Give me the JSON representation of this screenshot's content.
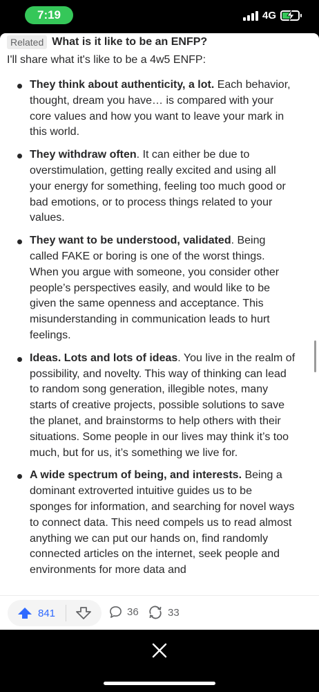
{
  "status": {
    "time": "7:19",
    "network": "4G"
  },
  "related": {
    "tag": "Related",
    "title": "What is it like to be an ENFP?"
  },
  "intro": "I'll share what it's like to be a 4w5 ENFP:",
  "points": [
    {
      "bold": "They think about authenticity, a lot.",
      "text": " Each behavior, thought, dream you have… is compared with your core values and how you want to leave your mark in this world."
    },
    {
      "bold": "They withdraw often",
      "text": ". It can either be due to overstimulation, getting really excited and using all your energy for something, feeling too much good or bad emotions, or to process things related to your values."
    },
    {
      "bold": "They want to be understood, validated",
      "text": ". Being called FAKE or boring is one of the worst things. When you argue with someone, you consider other people’s perspectives easily, and would like to be given the same openness and acceptance. This misunderstanding in communication leads to hurt feelings."
    },
    {
      "bold": "Ideas. Lots and lots of ideas",
      "text": ". You live in the realm of possibility, and novelty. This way of thinking can lead to random song generation, illegible notes, many starts of creative projects, possible solutions to save the planet, and brainstorms to help others with their situations. Some people in our lives may think it’s too much, but for us, it’s something we live for."
    },
    {
      "bold": "A wide spectrum of being, and interests.",
      "text": " Being a dominant extroverted intuitive guides us to be sponges for information, and searching for novel ways to connect data. This need compels us to read almost anything we can put our hands on, find randomly connected articles on the internet, seek people and environments for more data and"
    }
  ],
  "actions": {
    "upvotes": "841",
    "comments": "36",
    "shares": "33"
  },
  "colors": {
    "accent": "#2e69ff",
    "time_pill": "#35c759",
    "text": "#282829"
  },
  "icons": [
    "upvote-icon",
    "downvote-icon",
    "comment-icon",
    "share-icon",
    "close-icon"
  ]
}
